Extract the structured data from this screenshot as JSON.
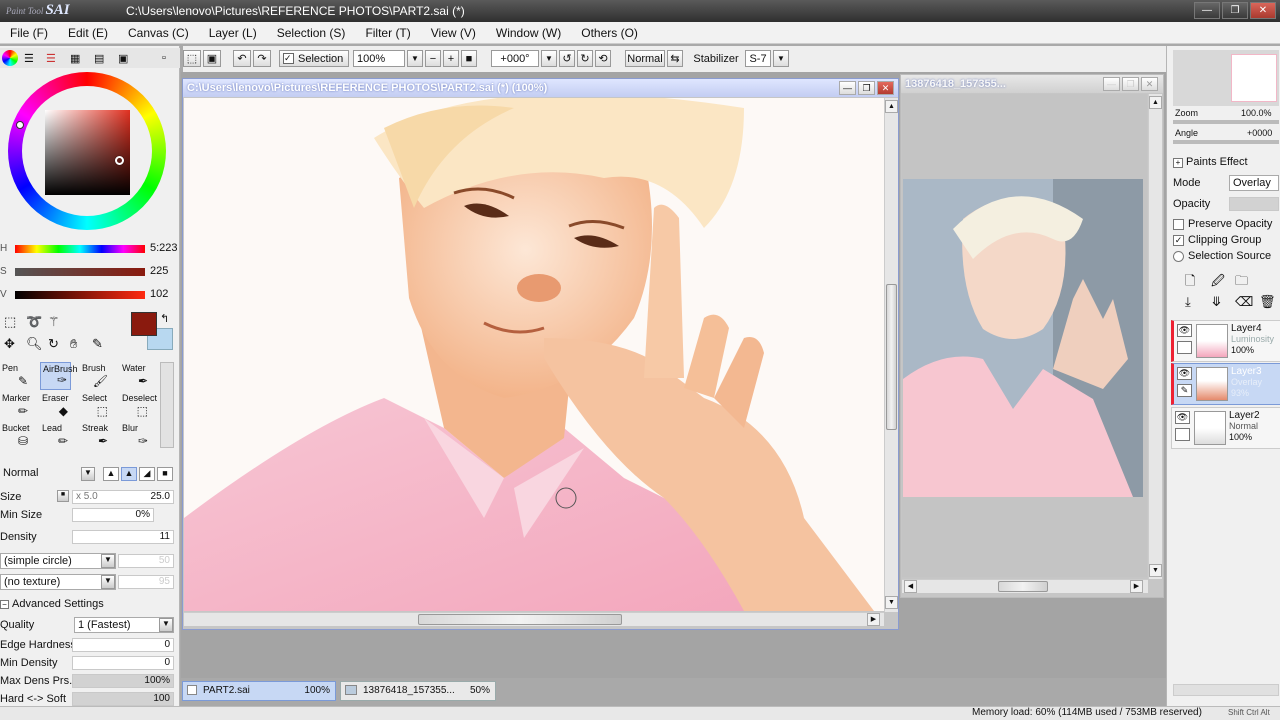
{
  "titlebar": {
    "logo_small": "Paint Tool",
    "logo": "SAI",
    "title": "C:\\Users\\lenovo\\Pictures\\REFERENCE PHOTOS\\PART2.sai (*)"
  },
  "menu": [
    "File (F)",
    "Edit (E)",
    "Canvas (C)",
    "Layer (L)",
    "Selection (S)",
    "Filter (T)",
    "View (V)",
    "Window (W)",
    "Others (O)"
  ],
  "toolbar": {
    "selection_label": "Selection",
    "zoom": "100%",
    "angle": "+000°",
    "mode": "Normal",
    "stabilizer_label": "Stabilizer",
    "stabilizer_value": "S-7"
  },
  "color": {
    "h_label": "H",
    "h_value": "5:223",
    "s_label": "S",
    "s_value": "225",
    "v_label": "V",
    "v_value": "102",
    "main_color": "#8a1a0e",
    "secondary_color": "#b8d8f0"
  },
  "tools": [
    {
      "label": "Pen",
      "icon": "pen-icon"
    },
    {
      "label": "AirBrush",
      "icon": "airbrush-icon"
    },
    {
      "label": "Brush",
      "icon": "brush-icon"
    },
    {
      "label": "Water",
      "icon": "water-icon"
    },
    {
      "label": "Marker",
      "icon": "marker-icon"
    },
    {
      "label": "Eraser",
      "icon": "eraser-icon"
    },
    {
      "label": "Select",
      "icon": "select-icon"
    },
    {
      "label": "Deselect",
      "icon": "deselect-icon"
    },
    {
      "label": "Bucket",
      "icon": "bucket-icon"
    },
    {
      "label": "Lead",
      "icon": "lead-icon"
    },
    {
      "label": "Streak",
      "icon": "streak-icon"
    },
    {
      "label": "Blur",
      "icon": "blur-icon"
    }
  ],
  "brush": {
    "blend_mode": "Normal",
    "size_label": "Size",
    "size_mult": "x 5.0",
    "size_value": "25.0",
    "min_size_label": "Min Size",
    "min_size_value": "0%",
    "density_label": "Density",
    "density_value": "11",
    "shape": "(simple circle)",
    "shape_value": "50",
    "texture": "(no texture)",
    "texture_value": "95",
    "advanced_label": "Advanced Settings",
    "quality_label": "Quality",
    "quality_value": "1 (Fastest)",
    "edge_hardness_label": "Edge Hardness",
    "edge_hardness_value": "0",
    "min_density_label": "Min Density",
    "min_density_value": "0",
    "max_dens_label": "Max Dens Prs.",
    "max_dens_value": "100%",
    "hard_soft_label": "Hard <-> Soft",
    "hard_soft_value": "100"
  },
  "canvas_window": {
    "title": "C:\\Users\\lenovo\\Pictures\\REFERENCE PHOTOS\\PART2.sai (*) (100%)"
  },
  "ref_window": {
    "title": "13876418_157355..."
  },
  "nav": {
    "zoom_label": "Zoom",
    "zoom_value": "100.0%",
    "angle_label": "Angle",
    "angle_value": "+0000"
  },
  "layers_panel": {
    "paints_effect": "Paints Effect",
    "mode_label": "Mode",
    "mode_value": "Overlay",
    "opacity_label": "Opacity",
    "preserve_opacity": "Preserve Opacity",
    "clipping_group": "Clipping Group",
    "selection_source": "Selection Source",
    "layers": [
      {
        "name": "Layer4",
        "mode": "Luminosity",
        "opacity": "100%"
      },
      {
        "name": "Layer3",
        "mode": "Overlay",
        "opacity": "93%"
      },
      {
        "name": "Layer2",
        "mode": "Normal",
        "opacity": "100%"
      }
    ]
  },
  "tabs": [
    {
      "name": "PART2.sai",
      "zoom": "100%"
    },
    {
      "name": "13876418_157355...",
      "zoom": "50%"
    }
  ],
  "status": {
    "memory": "Memory load: 60% (114MB used / 753MB reserved)",
    "keys": "Shift Ctrl Alt"
  }
}
